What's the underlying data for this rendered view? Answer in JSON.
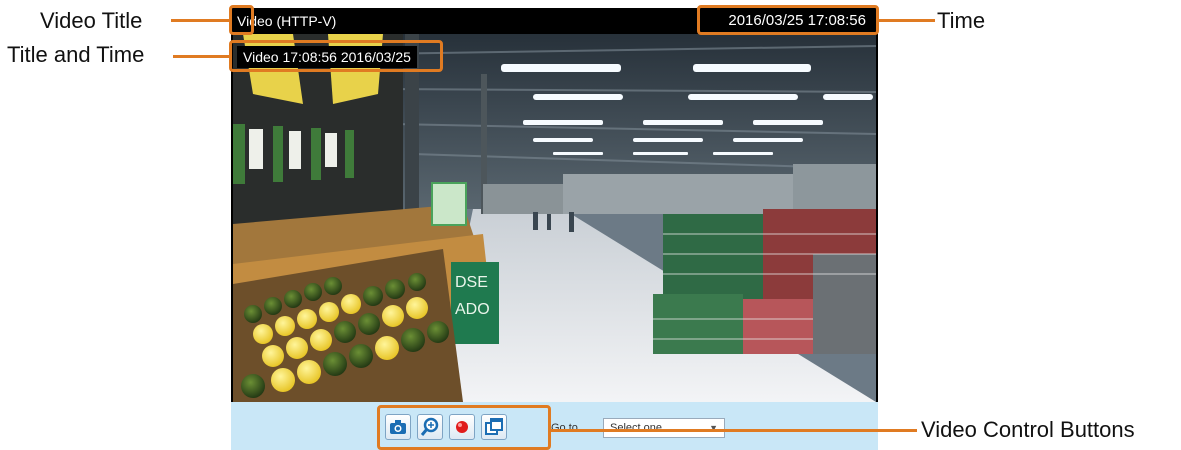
{
  "callouts": {
    "video_title": "Video Title",
    "title_and_time": "Title and Time",
    "time": "Time",
    "video_control_buttons": "Video Control Buttons"
  },
  "viewer": {
    "video_title": "Video (HTTP-V)",
    "time": "2016/03/25  17:08:56",
    "overlay_text": "Video 17:08:56  2016/03/25"
  },
  "store_sign": {
    "line1": "DSE",
    "line2": "ADO"
  },
  "controls": {
    "buttons": [
      {
        "name": "snapshot",
        "icon": "camera-icon"
      },
      {
        "name": "digital-zoom",
        "icon": "magnifier-icon"
      },
      {
        "name": "record",
        "icon": "record-icon"
      },
      {
        "name": "full-screen",
        "icon": "window-icon"
      }
    ],
    "goto_label": "Go to",
    "goto_value": "Select one"
  },
  "colors": {
    "accent": "#e07b22",
    "control_bar": "#c9e7f7"
  }
}
